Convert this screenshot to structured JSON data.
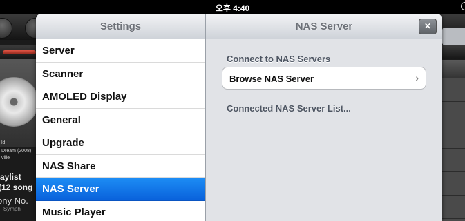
{
  "status_bar": {
    "time": "오후 4:40"
  },
  "background_app": {
    "album_line1": "ld",
    "album_line2": "Dream (2008)",
    "album_line3": "ville",
    "playlist_label": "aylist",
    "songs_count": "(12 song",
    "song_title": "ony No.",
    "song_subtitle": "n: Symph",
    "seek_color": "#c0392b"
  },
  "popover": {
    "master": {
      "title": "Settings",
      "items": [
        {
          "label": "Server"
        },
        {
          "label": "Scanner"
        },
        {
          "label": "AMOLED Display"
        },
        {
          "label": "General"
        },
        {
          "label": "Upgrade"
        },
        {
          "label": "NAS Share"
        },
        {
          "label": "NAS Server",
          "selected": true
        },
        {
          "label": "Music Player"
        }
      ]
    },
    "detail": {
      "title": "NAS Server",
      "close_icon": "close-icon",
      "section1_header": "Connect to NAS Servers",
      "browse_label": "Browse NAS Server",
      "chevron": "›",
      "section2_header": "Connected NAS Server List..."
    },
    "selection_color": "#1477e8"
  }
}
